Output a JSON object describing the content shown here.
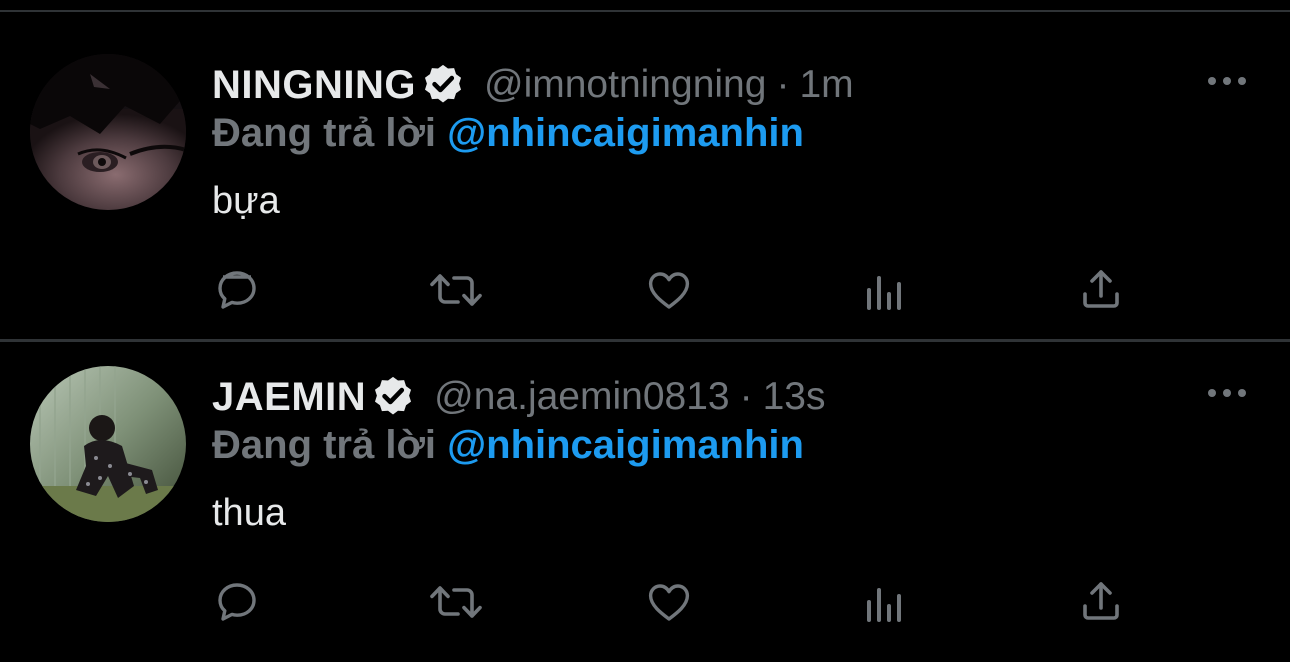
{
  "theme": {
    "background": "#000000",
    "text": "#e7e9ea",
    "secondary": "#71767b",
    "accent": "#1d9bf0",
    "divider": "#2f3336"
  },
  "tweets": [
    {
      "display_name": "NINGNING",
      "verified": true,
      "handle": "@imnotningning",
      "separator": "·",
      "time": "1m",
      "reply_prefix": "Đang trả lời ",
      "reply_to": "@nhincaigimanhin",
      "text": "bựa",
      "icons": [
        "reply-icon",
        "retweet-icon",
        "like-icon",
        "stats-icon",
        "share-icon",
        "more-icon"
      ]
    },
    {
      "display_name": "JAEMIN",
      "verified": true,
      "handle": "@na.jaemin0813",
      "separator": "·",
      "time": "13s",
      "reply_prefix": "Đang trả lời ",
      "reply_to": "@nhincaigimanhin",
      "text": "thua",
      "icons": [
        "reply-icon",
        "retweet-icon",
        "like-icon",
        "stats-icon",
        "share-icon",
        "more-icon"
      ]
    }
  ]
}
